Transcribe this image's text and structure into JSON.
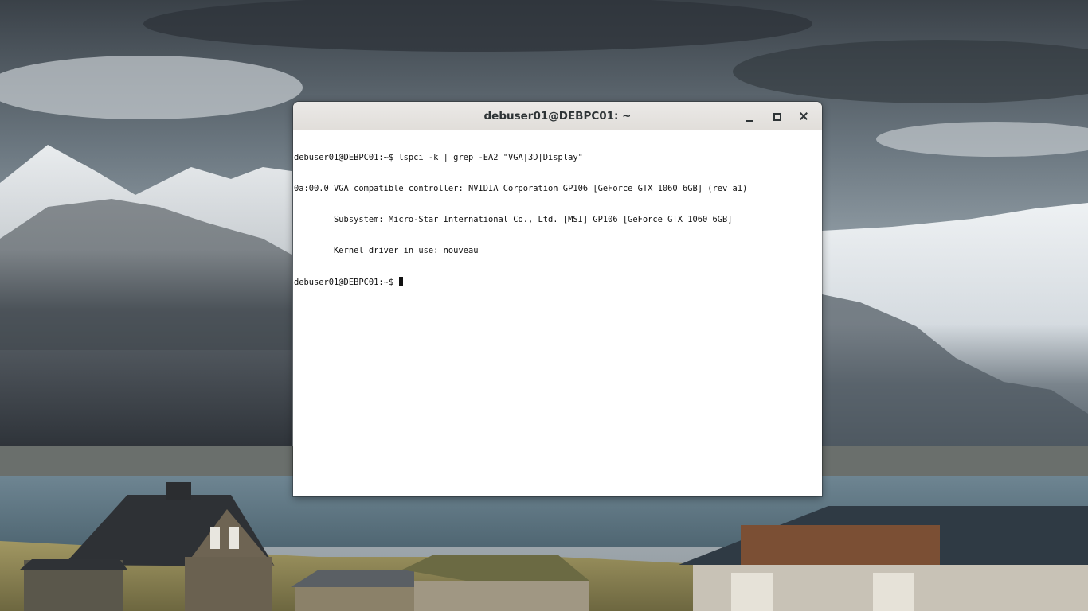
{
  "window": {
    "title": "debuser01@DEBPC01: ~",
    "controls": {
      "minimize_icon": "minimize-icon",
      "maximize_icon": "maximize-icon",
      "close_icon": "close-icon"
    }
  },
  "terminal": {
    "lines": [
      "debuser01@DEBPC01:~$ lspci -k | grep -EA2 \"VGA|3D|Display\"",
      "0a:00.0 VGA compatible controller: NVIDIA Corporation GP106 [GeForce GTX 1060 6GB] (rev a1)",
      "        Subsystem: Micro-Star International Co., Ltd. [MSI] GP106 [GeForce GTX 1060 6GB]",
      "        Kernel driver in use: nouveau"
    ],
    "prompt": "debuser01@DEBPC01:~$ ",
    "background": "#ffffff",
    "foreground": "#111111"
  }
}
